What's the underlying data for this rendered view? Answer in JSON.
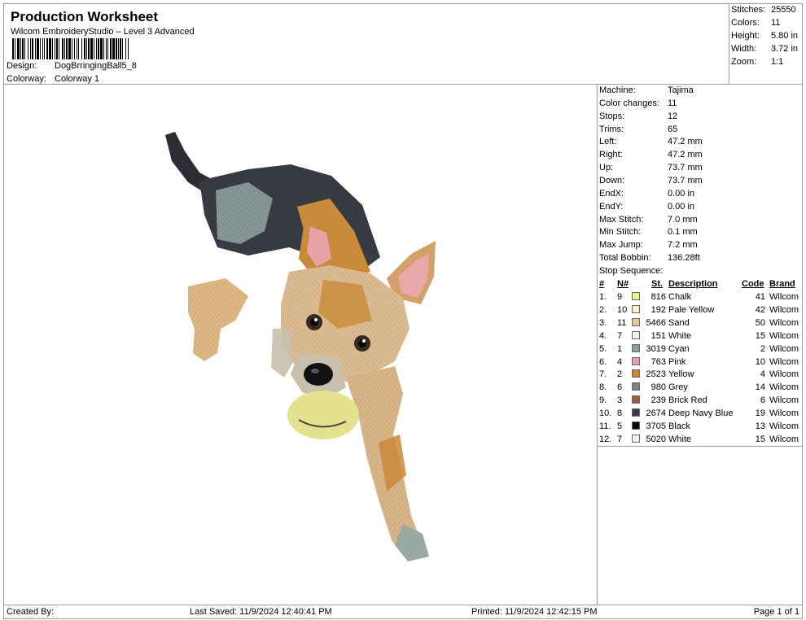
{
  "header": {
    "title": "Production Worksheet",
    "subtitle": "Wilcom EmbroideryStudio – Level 3 Advanced",
    "design_label": "Design:",
    "design_value": "DogBrringingBall5_8",
    "colorway_label": "Colorway:",
    "colorway_value": "Colorway 1"
  },
  "stats": [
    {
      "k": "Stitches:",
      "v": "25550"
    },
    {
      "k": "Colors:",
      "v": "11"
    },
    {
      "k": "Height:",
      "v": "5.80 in"
    },
    {
      "k": "Width:",
      "v": "3.72 in"
    },
    {
      "k": "Zoom:",
      "v": "1:1"
    }
  ],
  "machine": [
    {
      "k": "Machine:",
      "v": "Tajima"
    },
    {
      "k": "Color changes:",
      "v": "11"
    },
    {
      "k": "Stops:",
      "v": "12"
    },
    {
      "k": "Trims:",
      "v": "65"
    },
    {
      "k": "Left:",
      "v": "47.2 mm"
    },
    {
      "k": "Right:",
      "v": "47.2 mm"
    },
    {
      "k": "Up:",
      "v": "73.7 mm"
    },
    {
      "k": "Down:",
      "v": "73.7 mm"
    },
    {
      "k": "EndX:",
      "v": "0.00 in"
    },
    {
      "k": "EndY:",
      "v": "0.00 in"
    },
    {
      "k": "Max Stitch:",
      "v": "7.0 mm"
    },
    {
      "k": "Min Stitch:",
      "v": "0.1 mm"
    },
    {
      "k": "Max Jump:",
      "v": "7.2 mm"
    },
    {
      "k": "Total Bobbin:",
      "v": "136.28ft"
    }
  ],
  "stop_sequence": {
    "title": "Stop Sequence:",
    "columns": {
      "idx": "#",
      "n": "N#",
      "st": "St.",
      "desc": "Description",
      "code": "Code",
      "brand": "Brand"
    },
    "rows": [
      {
        "idx": "1.",
        "n": "9",
        "st": "816",
        "desc": "Chalk",
        "code": "41",
        "brand": "Wilcom",
        "color": "#f2f08a"
      },
      {
        "idx": "2.",
        "n": "10",
        "st": "192",
        "desc": "Pale Yellow",
        "code": "42",
        "brand": "Wilcom",
        "color": "#f4f3c9"
      },
      {
        "idx": "3.",
        "n": "11",
        "st": "5466",
        "desc": "Sand",
        "code": "50",
        "brand": "Wilcom",
        "color": "#ecc49a"
      },
      {
        "idx": "4.",
        "n": "7",
        "st": "151",
        "desc": "White",
        "code": "15",
        "brand": "Wilcom",
        "color": "#f2f2f2"
      },
      {
        "idx": "5.",
        "n": "1",
        "st": "3019",
        "desc": "Cyan",
        "code": "2",
        "brand": "Wilcom",
        "color": "#8a9ea0"
      },
      {
        "idx": "6.",
        "n": "4",
        "st": "763",
        "desc": "Pink",
        "code": "10",
        "brand": "Wilcom",
        "color": "#e8a0a6"
      },
      {
        "idx": "7.",
        "n": "2",
        "st": "2523",
        "desc": "Yellow",
        "code": "4",
        "brand": "Wilcom",
        "color": "#d0862e"
      },
      {
        "idx": "8.",
        "n": "6",
        "st": "980",
        "desc": "Grey",
        "code": "14",
        "brand": "Wilcom",
        "color": "#808080"
      },
      {
        "idx": "9.",
        "n": "3",
        "st": "239",
        "desc": "Brick Red",
        "code": "6",
        "brand": "Wilcom",
        "color": "#a0603a"
      },
      {
        "idx": "10.",
        "n": "8",
        "st": "2674",
        "desc": "Deep Navy Blue",
        "code": "19",
        "brand": "Wilcom",
        "color": "#3a3e4a"
      },
      {
        "idx": "11.",
        "n": "5",
        "st": "3705",
        "desc": "Black",
        "code": "13",
        "brand": "Wilcom",
        "color": "#0a0a0a"
      },
      {
        "idx": "12.",
        "n": "7",
        "st": "5020",
        "desc": "White",
        "code": "15",
        "brand": "Wilcom",
        "color": "#f2f2f2"
      }
    ]
  },
  "footer": {
    "created": "Created By:",
    "saved": "Last Saved: 11/9/2024 12:40:41 PM",
    "printed": "Printed: 11/9/2024 12:42:15 PM",
    "page": "Page 1 of 1"
  }
}
